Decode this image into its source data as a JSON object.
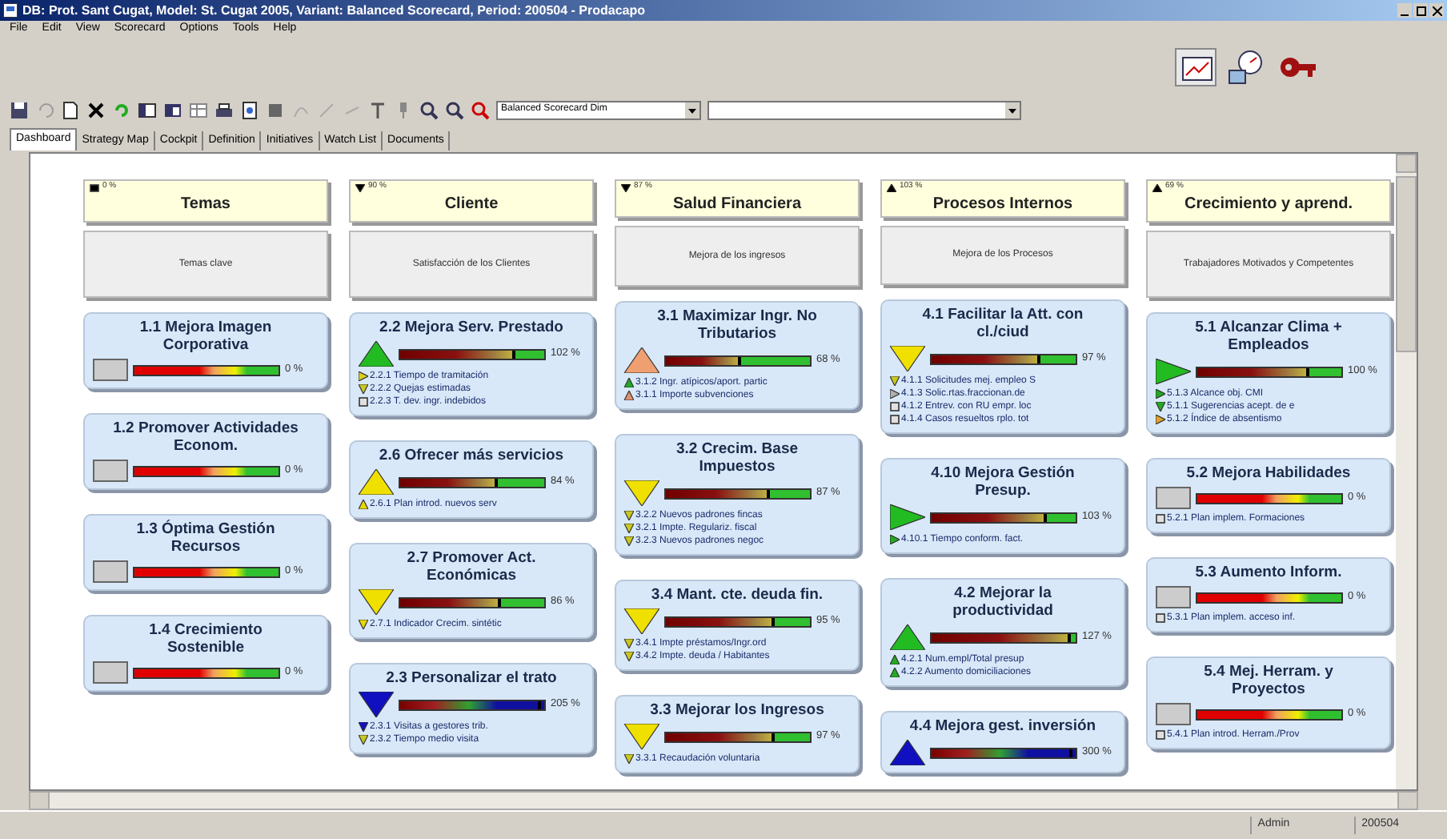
{
  "window": {
    "title": "DB: Prot. Sant Cugat, Model: St. Cugat 2005, Variant: Balanced Scorecard, Period: 200504 - Prodacapo"
  },
  "menu": [
    "File",
    "Edit",
    "View",
    "Scorecard",
    "Options",
    "Tools",
    "Help"
  ],
  "toolbar": {
    "dim_select": {
      "value": "Balanced Scorecard Dim"
    }
  },
  "tabs": [
    {
      "label": "Dashboard",
      "selected": true
    },
    {
      "label": "Strategy Map",
      "selected": false
    },
    {
      "label": "Cockpit",
      "selected": false
    },
    {
      "label": "Definition",
      "selected": false
    },
    {
      "label": "Initiatives",
      "selected": false
    },
    {
      "label": "Watch List",
      "selected": false
    },
    {
      "label": "Documents",
      "selected": false
    }
  ],
  "columns": [
    {
      "header": {
        "kind": "square",
        "pct": "0 %",
        "title": "Temas"
      },
      "theme": "Temas clave",
      "cards": [
        {
          "title": "1.1 Mejora Imagen Corporativa",
          "signal": {
            "kind": "none"
          },
          "gauge": {
            "kind": "inactive"
          },
          "reading": "0 %"
        },
        {
          "title": "1.2 Promover Actividades Econom.",
          "signal": {
            "kind": "none"
          },
          "gauge": {
            "kind": "inactive"
          },
          "reading": "0 %"
        },
        {
          "title": "1.3 Óptima Gestión Recursos",
          "signal": {
            "kind": "none"
          },
          "gauge": {
            "kind": "inactive"
          },
          "reading": "0 %"
        },
        {
          "title": "1.4 Crecimiento Sostenible",
          "signal": {
            "kind": "none"
          },
          "gauge": {
            "kind": "inactive"
          },
          "reading": "0 %"
        }
      ]
    },
    {
      "header": {
        "kind": "down",
        "pct": "90 %",
        "title": "Cliente"
      },
      "theme": "Satisfacción de los Clientes",
      "cards": [
        {
          "title": "2.2 Mejora Serv. Prestado",
          "signal": {
            "kind": "up",
            "color": "#22bb22"
          },
          "gauge": {
            "kind": "basic",
            "level": 0.8
          },
          "reading": "102 %",
          "items": [
            {
              "kind": "right",
              "color": "#d8d020",
              "text": "2.2.1 Tiempo de tramitación"
            },
            {
              "kind": "down",
              "color": "#c8c820",
              "text": "2.2.2 Quejas estimadas"
            },
            {
              "kind": "square",
              "color": "#e0e0e0",
              "text": "2.2.3 T. dev. ingr. indebidos"
            }
          ]
        },
        {
          "title": "2.6 Ofrecer más servicios",
          "signal": {
            "kind": "up",
            "color": "#f0e000"
          },
          "gauge": {
            "kind": "basic",
            "level": 0.68
          },
          "reading": "84 %",
          "items": [
            {
              "kind": "up",
              "color": "#e8d800",
              "text": "2.6.1 Plan introd. nuevos serv"
            }
          ]
        },
        {
          "title": "2.7 Promover Act. Económicas",
          "signal": {
            "kind": "down",
            "color": "#f0e000"
          },
          "gauge": {
            "kind": "basic",
            "level": 0.7
          },
          "reading": "86 %",
          "items": [
            {
              "kind": "down",
              "color": "#e8d800",
              "text": "2.7.1 Indicador Crecim. sintétic"
            }
          ]
        },
        {
          "title": "2.3 Personalizar el trato",
          "signal": {
            "kind": "down",
            "color": "#1010c0"
          },
          "gauge": {
            "kind": "extended",
            "level": 0.98
          },
          "reading": "205 %",
          "items": [
            {
              "kind": "down",
              "color": "#1010c0",
              "text": "2.3.1 Visitas a gestores trib."
            },
            {
              "kind": "down",
              "color": "#c8c820",
              "text": "2.3.2 Tiempo medio visita"
            }
          ]
        }
      ]
    },
    {
      "header": {
        "kind": "down",
        "pct": "87 %",
        "title": "Salud Financiera"
      },
      "theme": "Mejora de los ingresos",
      "cards": [
        {
          "title": "3.1 Maximizar Ingr. No Tributarios",
          "signal": {
            "kind": "up",
            "color": "#f0a070"
          },
          "gauge": {
            "kind": "basic",
            "level": 0.52
          },
          "reading": "68 %",
          "items": [
            {
              "kind": "up",
              "color": "#22aa22",
              "text": "3.1.2 Ingr. atípicos/aport. partic"
            },
            {
              "kind": "up",
              "color": "#e09070",
              "text": "3.1.1 Importe subvenciones"
            }
          ]
        },
        {
          "title": "3.2 Crecim. Base Impuestos",
          "signal": {
            "kind": "down",
            "color": "#f0e000"
          },
          "gauge": {
            "kind": "basic",
            "level": 0.72
          },
          "reading": "87 %",
          "items": [
            {
              "kind": "down",
              "color": "#c8c820",
              "text": "3.2.2 Nuevos padrones fincas"
            },
            {
              "kind": "down",
              "color": "#c8c820",
              "text": "3.2.1 Impte. Regulariz. fiscal"
            },
            {
              "kind": "down",
              "color": "#c8c820",
              "text": "3.2.3 Nuevos padrones negoc"
            }
          ]
        },
        {
          "title": "3.4 Mant. cte. deuda fin.",
          "signal": {
            "kind": "down",
            "color": "#f0e000"
          },
          "gauge": {
            "kind": "basic",
            "level": 0.75
          },
          "reading": "95 %",
          "items": [
            {
              "kind": "down",
              "color": "#c8c820",
              "text": "3.4.1 Impte préstamos/Ingr.ord"
            },
            {
              "kind": "down",
              "color": "#c8c820",
              "text": "3.4.2 Impte. deuda / Habitantes"
            }
          ]
        },
        {
          "title": "3.3 Mejorar los Ingresos",
          "signal": {
            "kind": "down",
            "color": "#f0e000"
          },
          "gauge": {
            "kind": "basic",
            "level": 0.75
          },
          "reading": "97 %",
          "items": [
            {
              "kind": "down",
              "color": "#c8c820",
              "text": "3.3.1 Recaudación voluntaria"
            }
          ]
        }
      ]
    },
    {
      "header": {
        "kind": "up",
        "pct": "103 %",
        "title": "Procesos Internos"
      },
      "theme": "Mejora de los Procesos",
      "cards": [
        {
          "title": "4.1 Facilitar la Att. con cl./ciud",
          "signal": {
            "kind": "down",
            "color": "#f0e000"
          },
          "gauge": {
            "kind": "basic",
            "level": 0.76
          },
          "reading": "97 %",
          "items": [
            {
              "kind": "down",
              "color": "#c8c820",
              "text": "4.1.1 Solicitudes mej. empleo S"
            },
            {
              "kind": "right",
              "color": "#b0b0b0",
              "text": "4.1.3 Solic.rtas.fraccionan.de"
            },
            {
              "kind": "square",
              "color": "#e0e0e0",
              "text": "4.1.2 Entrev. con RU empr. loc"
            },
            {
              "kind": "square",
              "color": "#e0e0e0",
              "text": "4.1.4 Casos resueltos rplo. tot"
            }
          ]
        },
        {
          "title": "4.10 Mejora Gestión Presup.",
          "signal": {
            "kind": "right",
            "color": "#22bb22"
          },
          "gauge": {
            "kind": "basic",
            "level": 0.8
          },
          "reading": "103 %",
          "items": [
            {
              "kind": "right",
              "color": "#22aa22",
              "text": "4.10.1 Tiempo conform. fact."
            }
          ]
        },
        {
          "title": "4.2 Mejorar la productividad",
          "signal": {
            "kind": "up",
            "color": "#22bb22"
          },
          "gauge": {
            "kind": "basic",
            "level": 0.97
          },
          "reading": "127 %",
          "items": [
            {
              "kind": "up",
              "color": "#22aa22",
              "text": "4.2.1 Num.empl/Total presup"
            },
            {
              "kind": "up",
              "color": "#22aa22",
              "text": "4.2.2 Aumento domiciliaciones"
            }
          ]
        },
        {
          "title": "4.4 Mejora gest. inversión",
          "signal": {
            "kind": "up",
            "color": "#1010c0"
          },
          "gauge": {
            "kind": "extended",
            "level": 0.98
          },
          "reading": "300 %"
        }
      ]
    },
    {
      "header": {
        "kind": "up",
        "pct": "69 %",
        "title": "Crecimiento y aprend."
      },
      "theme": "Trabajadores Motivados y Competentes",
      "cards": [
        {
          "title": "5.1 Alcanzar Clima + Empleados",
          "signal": {
            "kind": "right",
            "color": "#22bb22"
          },
          "gauge": {
            "kind": "basic",
            "level": 0.78
          },
          "reading": "100 %",
          "items": [
            {
              "kind": "right",
              "color": "#22aa22",
              "text": "5.1.3 Alcance obj. CMI"
            },
            {
              "kind": "down",
              "color": "#22aa22",
              "text": "5.1.1 Sugerencias acept. de e"
            },
            {
              "kind": "right",
              "color": "#e0a030",
              "text": "5.1.2 Índice de absentismo"
            }
          ]
        },
        {
          "title": "5.2 Mejora Habilidades",
          "signal": {
            "kind": "none"
          },
          "gauge": {
            "kind": "inactive"
          },
          "reading": "0 %",
          "items": [
            {
              "kind": "square",
              "color": "#e0e0e0",
              "text": "5.2.1 Plan implem. Formaciones"
            }
          ]
        },
        {
          "title": "5.3 Aumento Inform.",
          "signal": {
            "kind": "none"
          },
          "gauge": {
            "kind": "inactive"
          },
          "reading": "0 %",
          "items": [
            {
              "kind": "square",
              "color": "#e0e0e0",
              "text": "5.3.1 Plan implem. acceso inf."
            }
          ]
        },
        {
          "title": "5.4 Mej. Herram. y Proyectos",
          "signal": {
            "kind": "none"
          },
          "gauge": {
            "kind": "inactive"
          },
          "reading": "0 %",
          "items": [
            {
              "kind": "square",
              "color": "#e0e0e0",
              "text": "5.4.1 Plan introd. Herram./Prov"
            }
          ]
        }
      ]
    }
  ],
  "status_bar": [
    "Admin",
    "200504"
  ]
}
